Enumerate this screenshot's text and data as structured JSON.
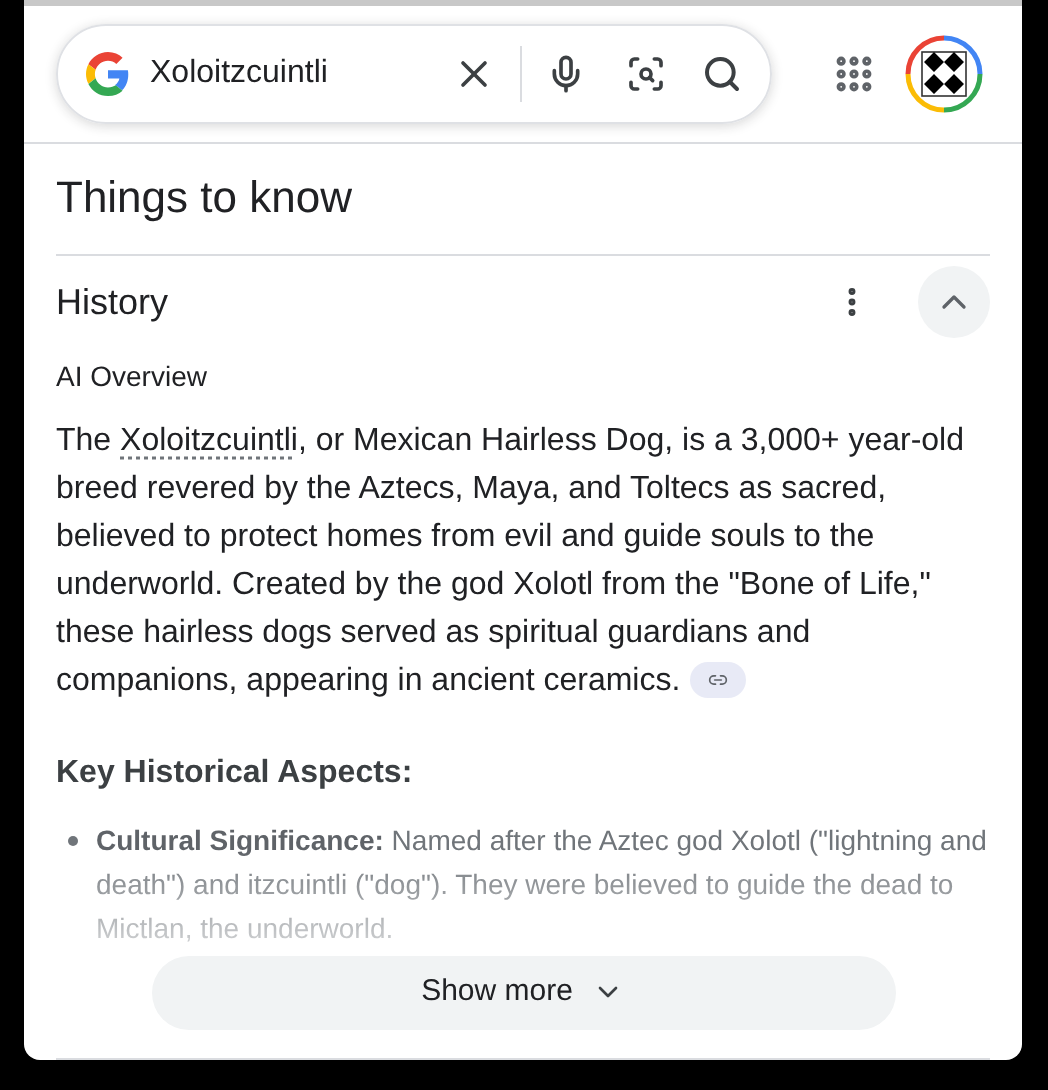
{
  "search": {
    "value": "Xoloitzcuintli"
  },
  "section_title": "Things to know",
  "topic": {
    "title": "History",
    "expanded": true
  },
  "overview_label": "AI Overview",
  "paragraph": {
    "before": "The ",
    "term": "Xoloitzcuintli",
    "after": ", or Mexican Hairless Dog, is a 3,000+ year-old breed revered by the Aztecs, Maya, and Toltecs as sacred, believed to protect homes from evil and guide souls to the underworld. Created by the god Xolotl from the \"Bone of Life,\" these hairless dogs served as spiritual guardians and companions, appearing in ancient ceramics."
  },
  "heading": "Key Historical Aspects:",
  "bullets": [
    "**Cultural Significance:** Named after the Aztec god Xolotl (\"lightning and death\") and itzcuintli (\"dog\"). They were believed to guide the dead to Mictlan, the underworld."
  ],
  "show_more": "Show more"
}
